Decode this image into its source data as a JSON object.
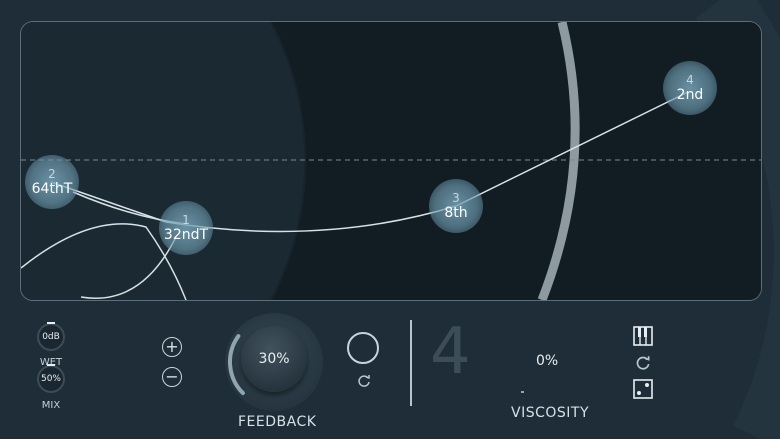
{
  "nodes": [
    {
      "index": "1",
      "value": "32ndT"
    },
    {
      "index": "2",
      "value": "64thT"
    },
    {
      "index": "3",
      "value": "8th"
    },
    {
      "index": "4",
      "value": "2nd"
    }
  ],
  "wet": {
    "value": "0dB",
    "label": "WET"
  },
  "mix": {
    "value": "50%",
    "label": "MIX"
  },
  "feedback": {
    "value": "30%",
    "label": "FEEDBACK",
    "level": 0.3
  },
  "voices": {
    "count": "4"
  },
  "viscosity": {
    "value": "0%",
    "label": "VISCOSITY"
  },
  "icons": {
    "plus": "plus-icon",
    "minus": "minus-icon",
    "reset": "refresh-icon",
    "piano": "piano-keys-icon",
    "dice": "dice-icon"
  },
  "colors": {
    "accent": "#8fa6b1",
    "background": "#1e2d38",
    "panel": "#15222b"
  }
}
